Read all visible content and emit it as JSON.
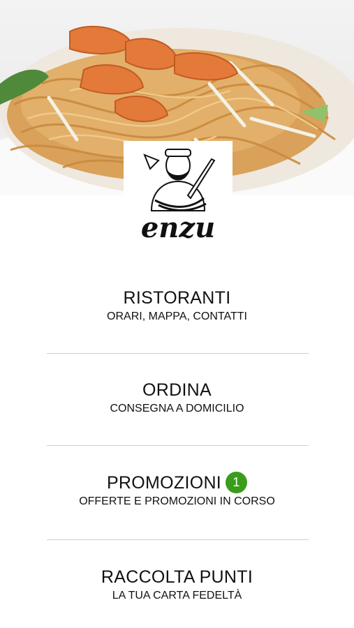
{
  "brand": {
    "logo_text": "enzu"
  },
  "hero": {
    "image": "shrimp-pad-thai-photo"
  },
  "menu": [
    {
      "title": "RISTORANTI",
      "subtitle": "ORARI, MAPPA, CONTATTI"
    },
    {
      "title": "ORDINA",
      "subtitle": "CONSEGNA A DOMICILIO"
    },
    {
      "title": "PROMOZIONI",
      "subtitle": "OFFERTE E PROMOZIONI IN CORSO",
      "badge": "1"
    },
    {
      "title": "RACCOLTA PUNTI",
      "subtitle": "LA TUA CARTA FEDELTÀ"
    }
  ],
  "colors": {
    "badge": "#3a9c1a",
    "divider": "#cfcfcf"
  }
}
